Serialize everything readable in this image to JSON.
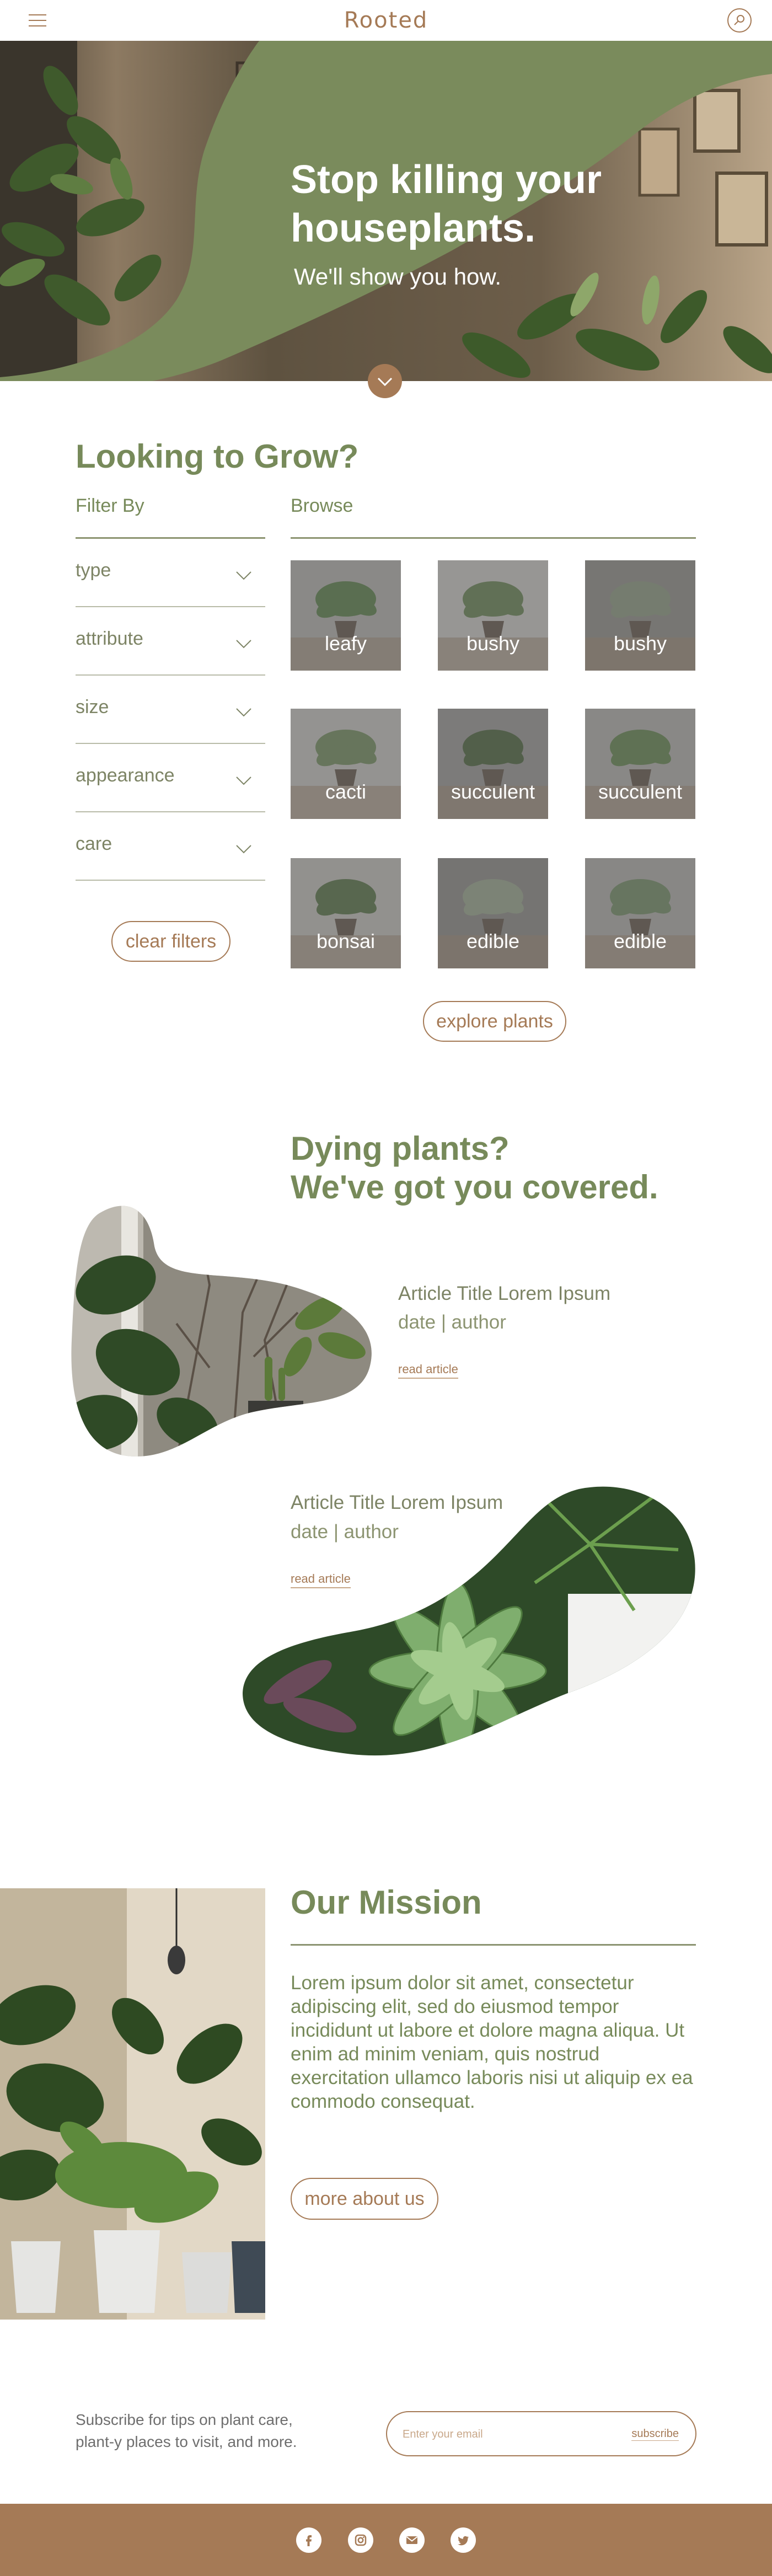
{
  "header": {
    "logo": "Rooted",
    "menu_icon": "hamburger-menu-icon",
    "search_icon": "search-icon"
  },
  "hero": {
    "title": "Stop killing your houseplants.",
    "subtitle": "We'll show you how.",
    "scroll_icon": "chevron-down-icon"
  },
  "grow": {
    "title": "Looking to Grow?",
    "filter_label": "Filter By",
    "browse_label": "Browse",
    "filters": [
      "type",
      "attribute",
      "size",
      "appearance",
      "care"
    ],
    "clear_button": "clear filters",
    "tiles": [
      "leafy",
      "bushy",
      "bushy",
      "cacti",
      "succulent",
      "succulent",
      "bonsai",
      "edible",
      "edible"
    ],
    "explore_button": "explore plants"
  },
  "articles": {
    "title_line1": "Dying plants?",
    "title_line2": "We've got you covered.",
    "items": [
      {
        "title": "Article Title Lorem Ipsum",
        "meta": "date | author",
        "link": "read article"
      },
      {
        "title": "Article Title Lorem Ipsum",
        "meta": "date | author",
        "link": "read article"
      }
    ]
  },
  "mission": {
    "title": "Our Mission",
    "text": "Lorem ipsum dolor sit amet, consectetur adipiscing elit, sed do eiusmod tempor incididunt ut labore et dolore magna aliqua. Ut enim ad minim veniam, quis nostrud exercitation ullamco laboris nisi ut aliquip ex ea commodo consequat.",
    "button": "more about us"
  },
  "subscribe": {
    "text": "Subscribe for tips on plant care, plant-y places to visit, and more.",
    "placeholder": "Enter your email",
    "button": "subscribe"
  },
  "footer": {
    "social_icons": [
      "facebook-icon",
      "instagram-icon",
      "email-icon",
      "twitter-icon"
    ]
  },
  "colors": {
    "olive": "#778a5a",
    "brown": "#a57a56",
    "hero_green": "#7a8b5c"
  }
}
